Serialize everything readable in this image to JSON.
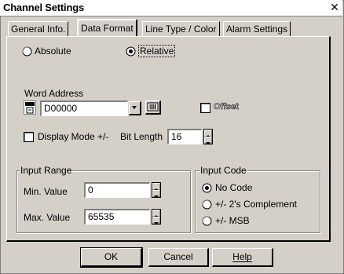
{
  "window": {
    "title": "Channel Settings",
    "close_glyph": "✕"
  },
  "tabs": [
    {
      "label": "General Info."
    },
    {
      "label": "Data Format"
    },
    {
      "label": "Line Type / Color"
    },
    {
      "label": "Alarm Settings"
    }
  ],
  "mode": {
    "absolute_label": "Absolute",
    "relative_label": "Relative",
    "selected": "Relative"
  },
  "word_address": {
    "label": "Word Address",
    "value": "D00000",
    "icon": "device-address-icon",
    "keypad_icon": "keypad-icon"
  },
  "offset": {
    "label": "Offset",
    "checked": false
  },
  "display_mode": {
    "label": "Display Mode +/-",
    "checked": false
  },
  "bit_length": {
    "label": "Bit Length",
    "value": "16"
  },
  "input_range": {
    "title": "Input Range",
    "min_label": "Min. Value",
    "min_value": "0",
    "max_label": "Max. Value",
    "max_value": "65535"
  },
  "input_code": {
    "title": "Input Code",
    "options": [
      "No Code",
      "+/- 2's Complement",
      "+/- MSB"
    ],
    "selected": "No Code"
  },
  "buttons": {
    "ok": "OK",
    "cancel": "Cancel",
    "help": "Help"
  },
  "colors": {
    "face": "#d4d0c8",
    "shadow": "#808080",
    "highlight": "#ffffff"
  }
}
